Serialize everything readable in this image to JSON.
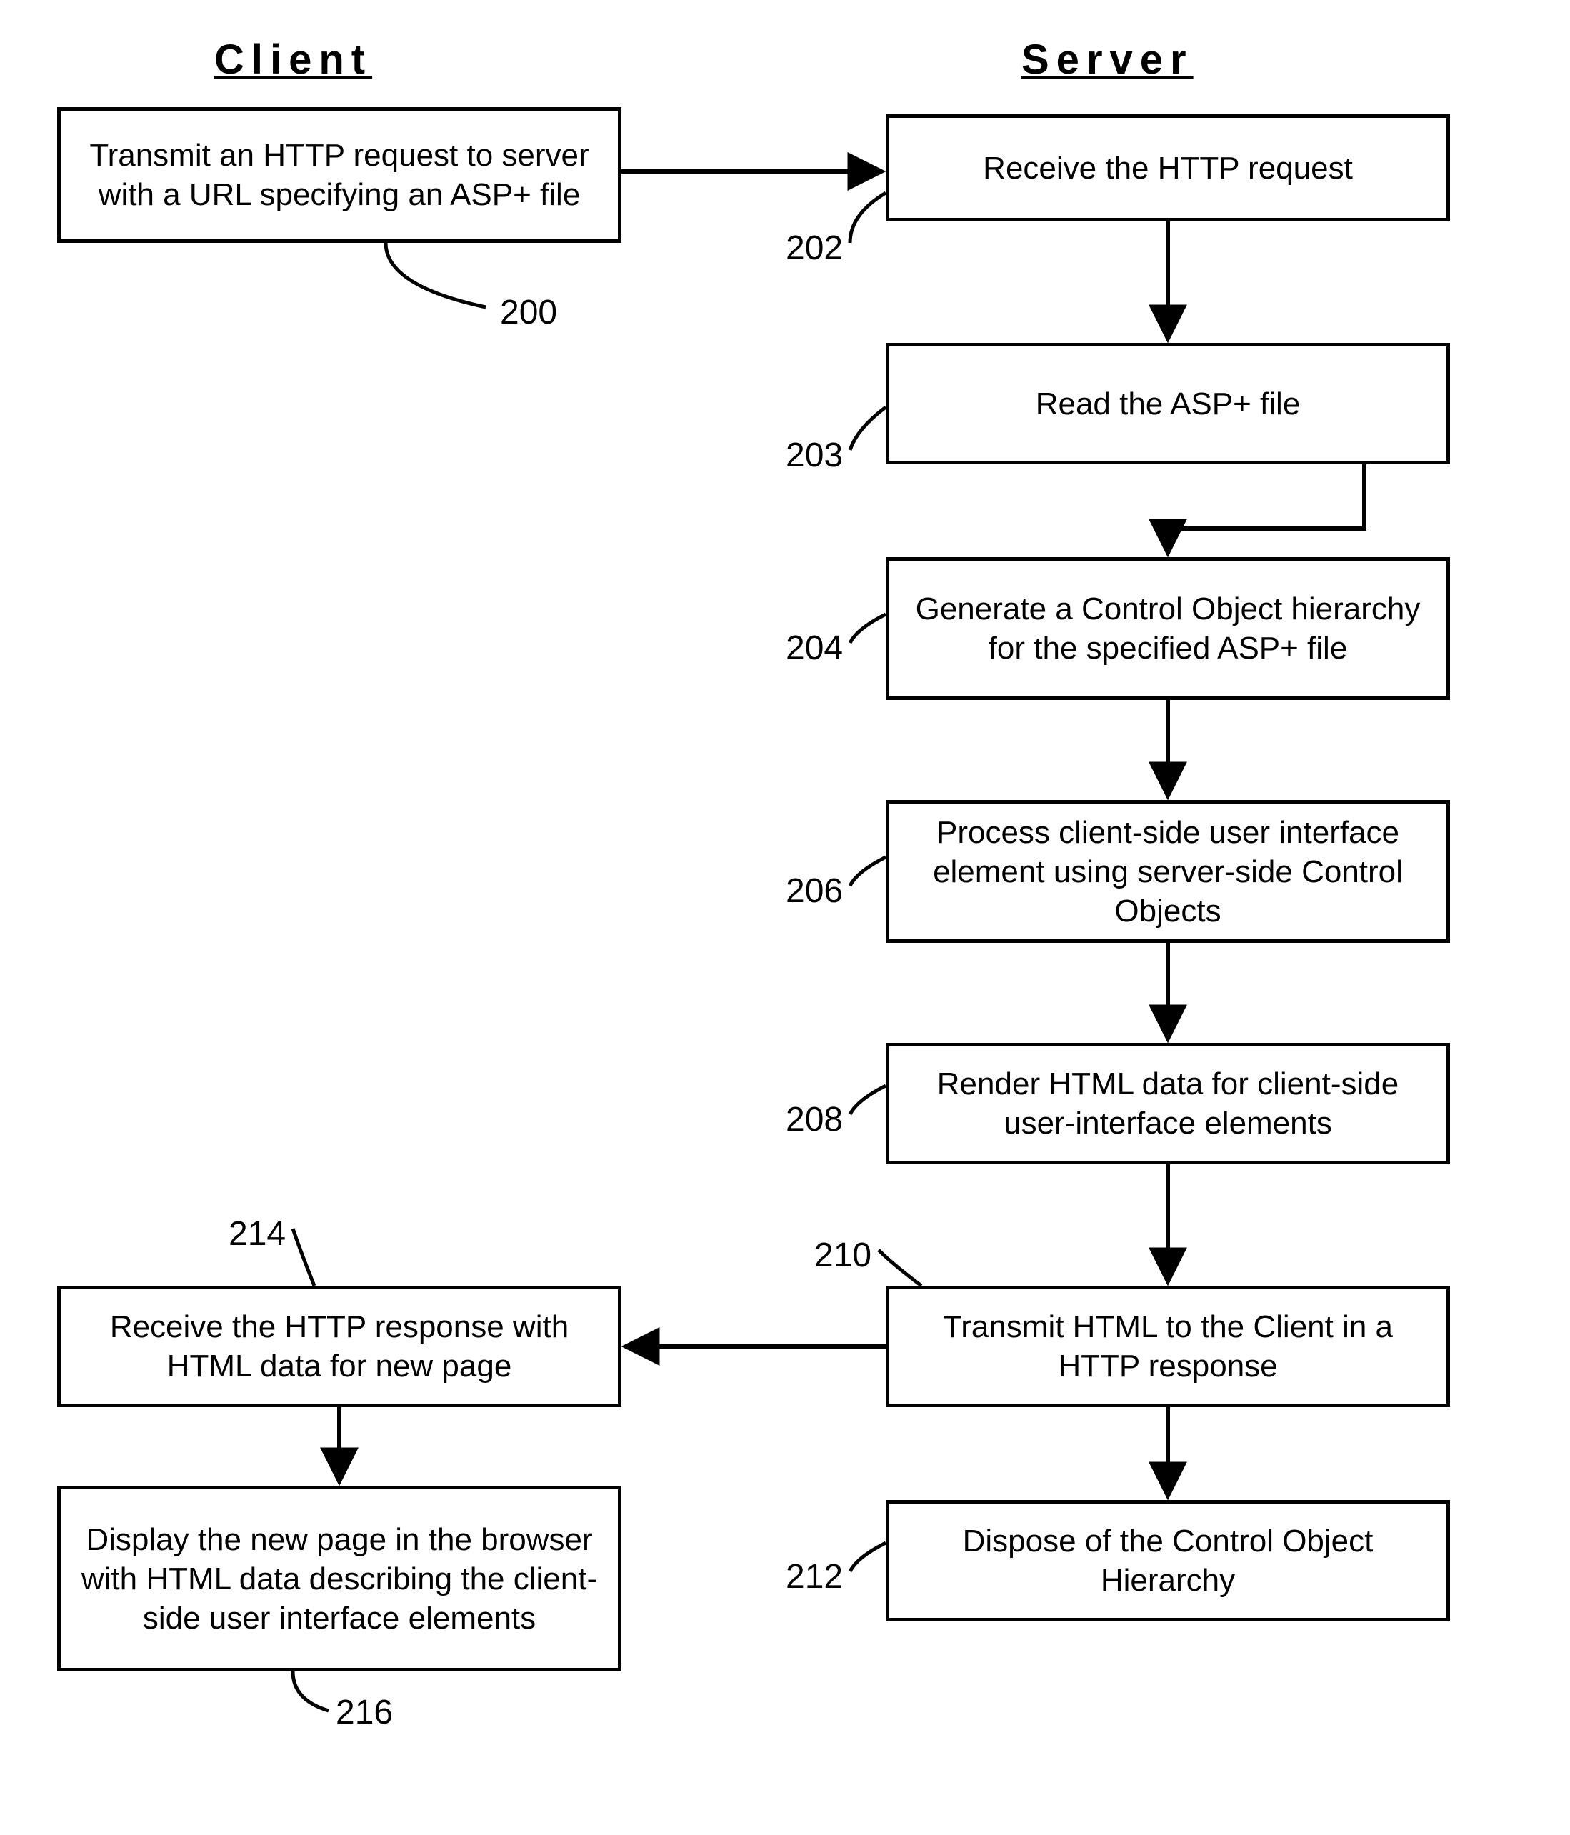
{
  "headings": {
    "client": "Client",
    "server": "Server"
  },
  "boxes": {
    "b200": "Transmit an HTTP request to server with a URL specifying an ASP+ file",
    "b202": "Receive the HTTP request",
    "b203": "Read the ASP+ file",
    "b204": "Generate a Control Object hierarchy for the specified ASP+ file",
    "b206": "Process client-side user interface element using server-side Control Objects",
    "b208": "Render HTML data for client-side user-interface elements",
    "b210": "Transmit HTML to the Client in a HTTP response",
    "b212": "Dispose of the Control Object Hierarchy",
    "b214": "Receive the HTTP response with HTML data for new page",
    "b216": "Display the new page in the browser with HTML data describing the client-side user interface elements"
  },
  "refs": {
    "r200": "200",
    "r202": "202",
    "r203": "203",
    "r204": "204",
    "r206": "206",
    "r208": "208",
    "r210": "210",
    "r212": "212",
    "r214": "214",
    "r216": "216"
  }
}
